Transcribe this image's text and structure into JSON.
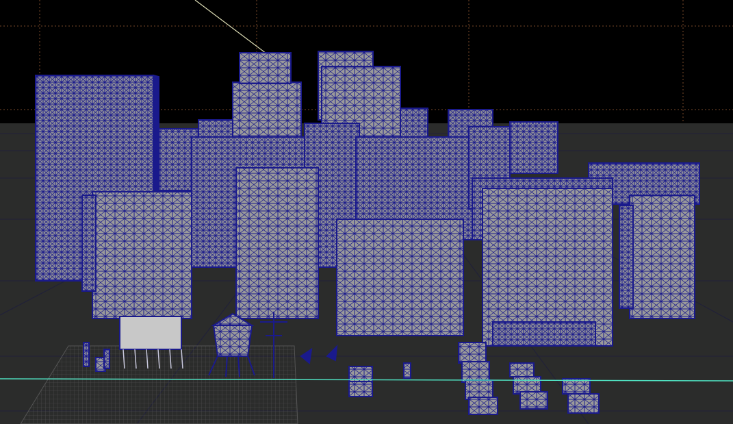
{
  "viewport": {
    "background_sky": "#000000",
    "ground_color": "#2b2c2b",
    "grid_line_color": "#20203a",
    "back_grid_color": "#7a4a2a",
    "wire_color": "#1a1a8c",
    "surface_color": "#9a9a9a",
    "horizon_line_color": "#4fe0c0",
    "light_ray_color": "#dcdcb4",
    "billboard_color": "#c8c8c8"
  },
  "scene": {
    "objects": [
      {
        "name": "skyscraper-far-left"
      },
      {
        "name": "tower-center-left"
      },
      {
        "name": "tower-center"
      },
      {
        "name": "building-left-front"
      },
      {
        "name": "building-center-front"
      },
      {
        "name": "building-middle-block"
      },
      {
        "name": "building-right-front"
      },
      {
        "name": "building-far-right"
      },
      {
        "name": "water-tower"
      },
      {
        "name": "billboard"
      },
      {
        "name": "street-props"
      },
      {
        "name": "crate-stacks"
      }
    ]
  }
}
